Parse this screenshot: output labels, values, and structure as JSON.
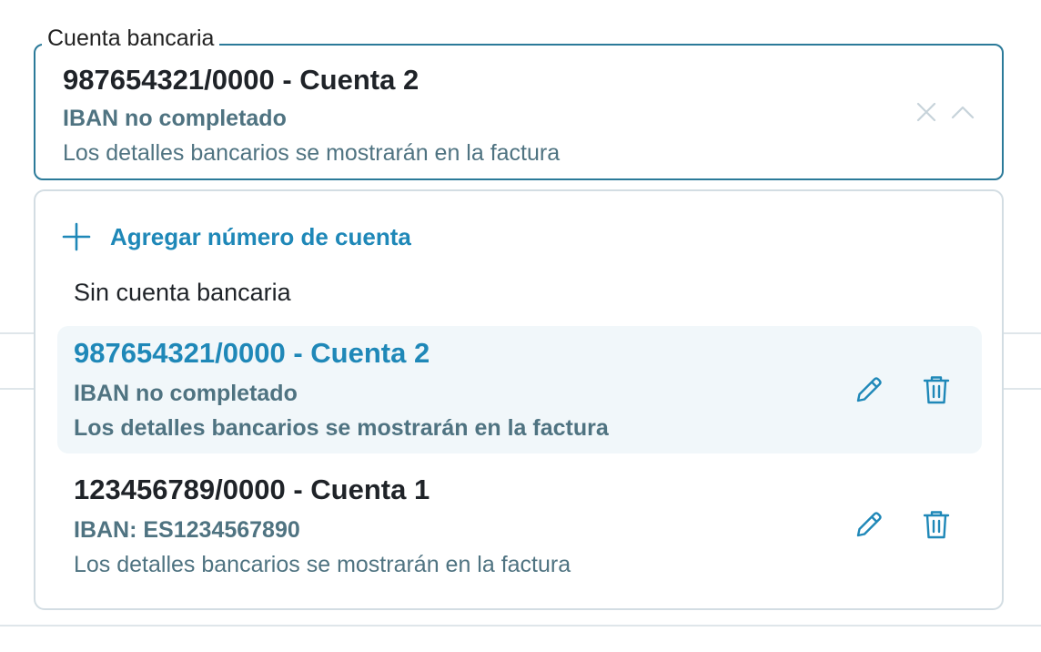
{
  "field": {
    "legend": "Cuenta bancaria",
    "selected_title": "987654321/0000 - Cuenta 2",
    "selected_iban": "IBAN no completado",
    "selected_note": "Los detalles bancarios se mostrarán en la factura"
  },
  "dropdown": {
    "add_label": "Agregar número de cuenta",
    "no_account_label": "Sin cuenta bancaria",
    "options": [
      {
        "title": "987654321/0000 - Cuenta 2",
        "iban": "IBAN no completado",
        "note": "Los detalles bancarios se mostrarán en la factura",
        "selected": true
      },
      {
        "title": "123456789/0000 - Cuenta 1",
        "iban": "IBAN: ES1234567890",
        "note": "Los detalles bancarios se mostrarán en la factura",
        "selected": false
      }
    ]
  },
  "icons": {
    "clear": "close-icon",
    "toggle": "chevron-up-icon",
    "add": "plus-icon",
    "edit": "pencil-icon",
    "delete": "trash-icon"
  },
  "colors": {
    "accent": "#1f88b8",
    "border_focus": "#2b7a99",
    "muted_text": "#4f7381",
    "selected_bg": "#f1f7fa"
  }
}
